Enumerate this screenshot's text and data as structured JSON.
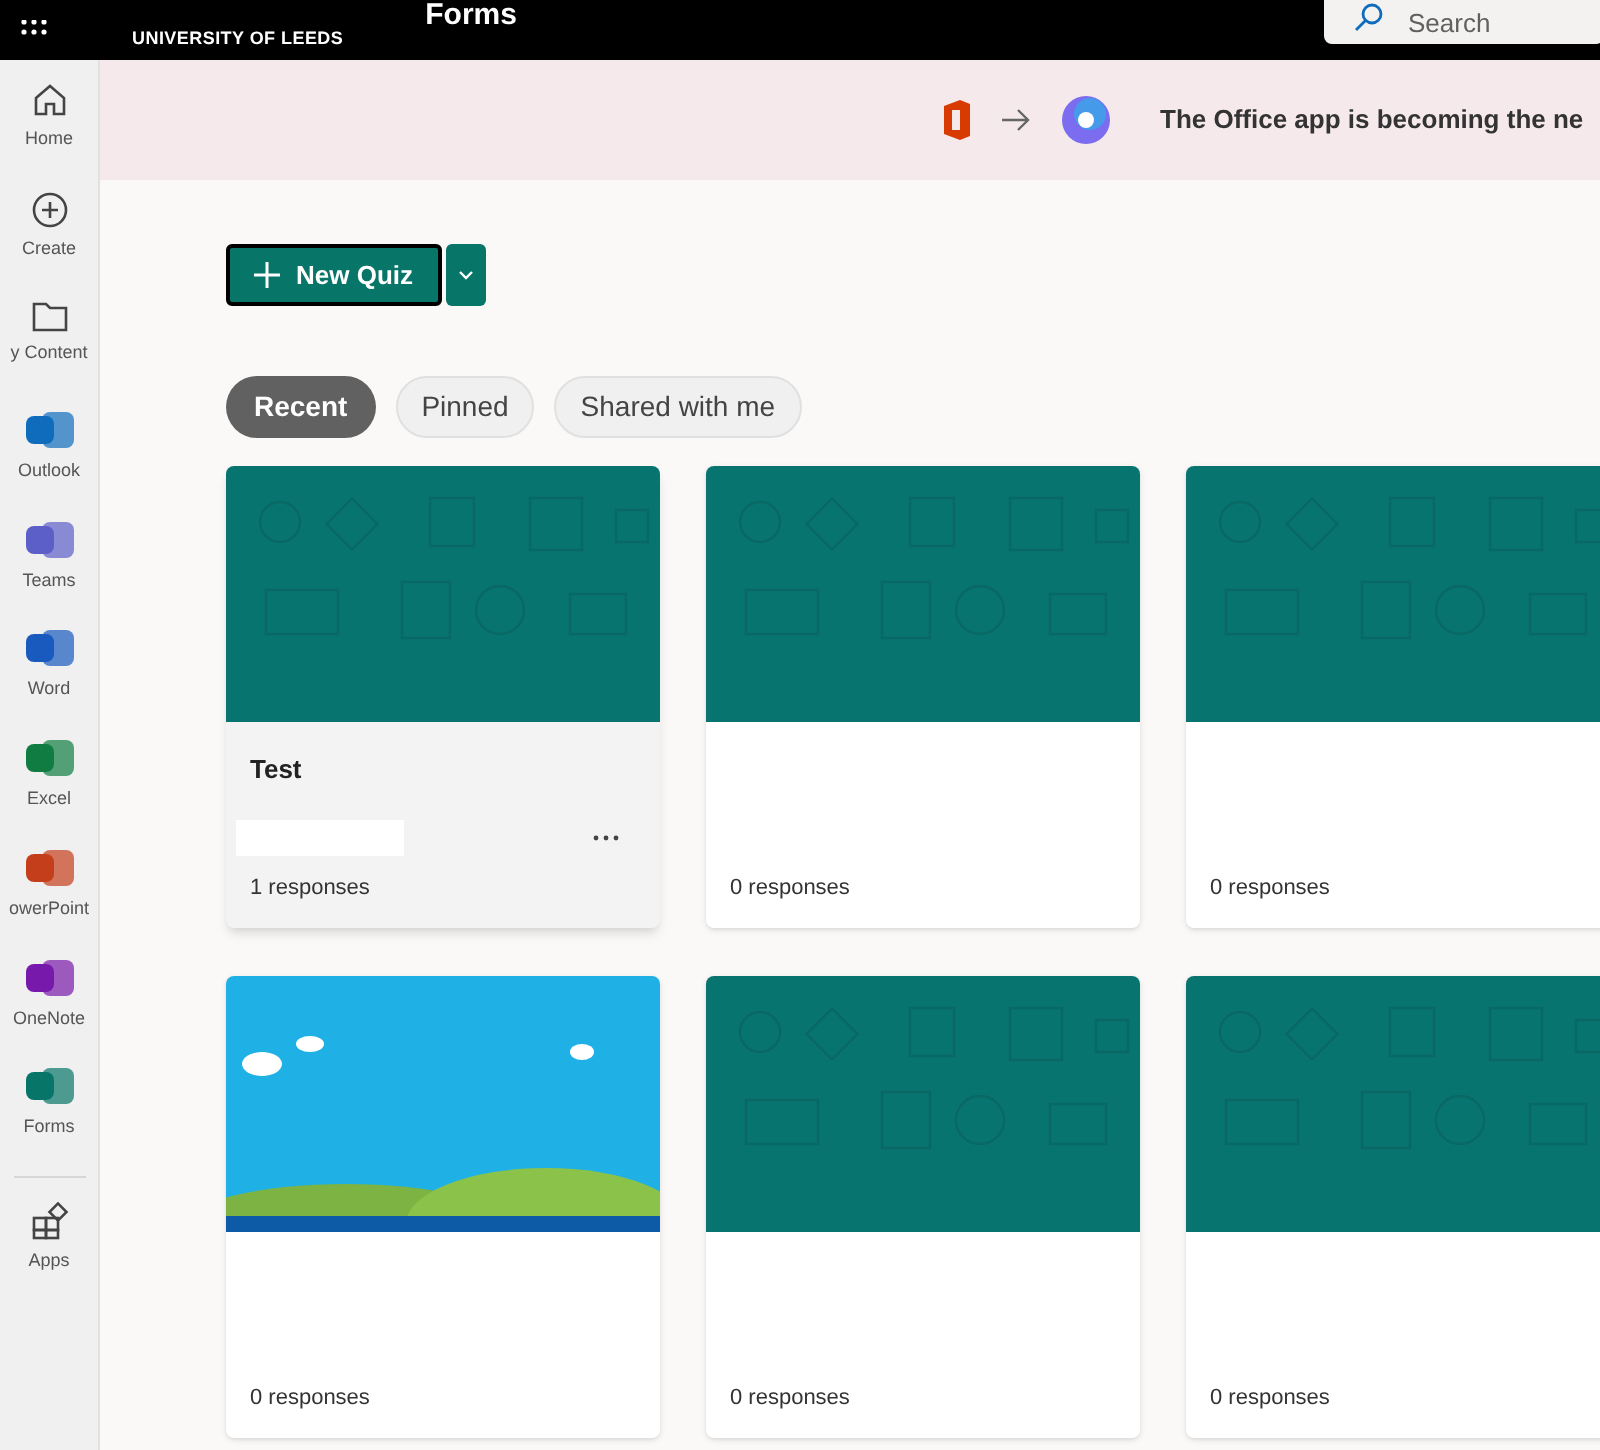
{
  "top_bar": {
    "logo": "UNIVERSITY OF LEEDS",
    "app_name": "Forms",
    "search": {
      "placeholder": "Search"
    }
  },
  "sidebar": {
    "items": [
      {
        "label": "Home",
        "kind": "home"
      },
      {
        "label": "Create",
        "kind": "create"
      },
      {
        "label": "y Content",
        "kind": "folder"
      },
      {
        "label": "Outlook",
        "kind": "outlook"
      },
      {
        "label": "Teams",
        "kind": "teams"
      },
      {
        "label": "Word",
        "kind": "word"
      },
      {
        "label": "Excel",
        "kind": "excel"
      },
      {
        "label": "owerPoint",
        "kind": "powerpoint"
      },
      {
        "label": "OneNote",
        "kind": "onenote"
      },
      {
        "label": "Forms",
        "kind": "forms"
      },
      {
        "label": "Apps",
        "kind": "apps"
      }
    ]
  },
  "banner": {
    "text": "The Office app is becoming the ne"
  },
  "new_button": {
    "label": "New Quiz"
  },
  "tabs": [
    {
      "label": "Recent",
      "selected": true
    },
    {
      "label": "Pinned",
      "selected": false
    },
    {
      "label": "Shared with me",
      "selected": false
    }
  ],
  "cards": [
    {
      "kind": "pattern",
      "title": "Test",
      "responses": "1 responses",
      "hovered": true
    },
    {
      "kind": "pattern",
      "responses": "0 responses",
      "hovered": false
    },
    {
      "kind": "pattern",
      "responses": "0 responses",
      "hovered": false
    },
    {
      "kind": "landscape",
      "responses": "0 responses",
      "hovered": false
    },
    {
      "kind": "pattern",
      "responses": "0 responses",
      "hovered": false
    },
    {
      "kind": "pattern",
      "responses": "0 responses",
      "hovered": false
    }
  ]
}
